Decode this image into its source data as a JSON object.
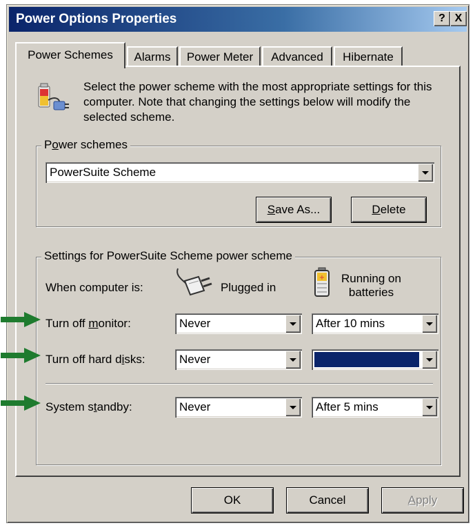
{
  "window": {
    "title": "Power Options Properties",
    "help_btn": "?",
    "close_btn": "X"
  },
  "tabs": [
    {
      "label": "Power Schemes",
      "active": true
    },
    {
      "label": "Alarms",
      "active": false
    },
    {
      "label": "Power Meter",
      "active": false
    },
    {
      "label": "Advanced",
      "active": false
    },
    {
      "label": "Hibernate",
      "active": false
    }
  ],
  "intro": {
    "icon": "power-scheme-icon",
    "text": "Select the power scheme with the most appropriate settings for this computer. Note that changing the settings below will modify the selected scheme."
  },
  "schemes_group": {
    "label_pre": "P",
    "label_u": "o",
    "label_post": "wer schemes",
    "selected": "PowerSuite Scheme",
    "save_as_pre": "",
    "save_as_u": "S",
    "save_as_post": "ave As...",
    "delete_pre": "",
    "delete_u": "D",
    "delete_post": "elete"
  },
  "settings_group": {
    "label": "Settings for PowerSuite Scheme power scheme",
    "when_label": "When computer is:",
    "plugged_in": "Plugged in",
    "batteries_line1": "Running on",
    "batteries_line2": "batteries",
    "rows": [
      {
        "label_pre": "Turn off ",
        "label_u": "m",
        "label_post": "onitor:",
        "plugged": "Never",
        "battery": "After 10 mins",
        "battery_highlighted": false
      },
      {
        "label_pre": "Turn off hard d",
        "label_u": "i",
        "label_post": "sks:",
        "plugged": "Never",
        "battery": "",
        "battery_highlighted": true
      },
      {
        "label_pre": "System s",
        "label_u": "t",
        "label_post": "andby:",
        "plugged": "Never",
        "battery": "After 5 mins",
        "battery_highlighted": false
      }
    ],
    "arrow_color": "#1e7b2e"
  },
  "footer": {
    "ok": "OK",
    "cancel": "Cancel",
    "apply_pre": "",
    "apply_u": "A",
    "apply_post": "pply"
  }
}
